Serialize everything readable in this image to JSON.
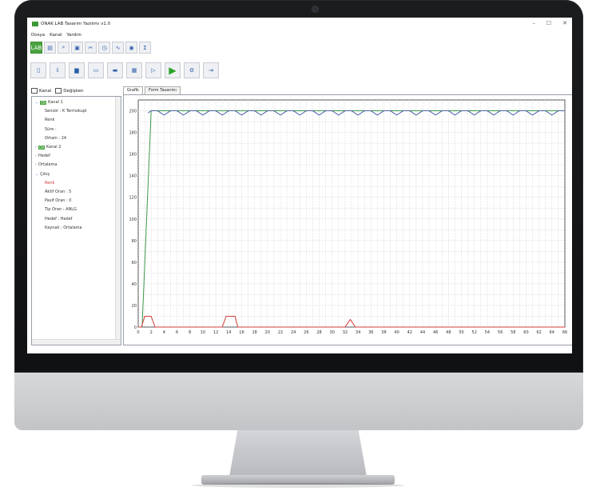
{
  "app": {
    "title": "ONAK LAB Tasarım Yazılımı v1.0"
  },
  "window_buttons": [
    "–",
    "☐",
    "✕"
  ],
  "menu": [
    "Dosya",
    "Kanal",
    "Yardım"
  ],
  "toolbar_row1": [
    {
      "icon": "lab-icon",
      "label": "LAB"
    },
    {
      "icon": "document-icon",
      "label": "▤"
    },
    {
      "icon": "search-doc-icon",
      "label": "⌕"
    },
    {
      "icon": "clipboard-icon",
      "label": "▣"
    },
    {
      "icon": "tools-icon",
      "label": "✂"
    },
    {
      "icon": "gauge-icon",
      "label": "◷"
    },
    {
      "icon": "wave-icon",
      "label": "∿"
    },
    {
      "icon": "eye-icon",
      "label": "◉"
    },
    {
      "icon": "sigma-icon",
      "label": "Σ"
    }
  ],
  "toolbar_row2": [
    {
      "icon": "new-file-icon",
      "label": "▯"
    },
    {
      "icon": "export-icon",
      "label": "⇩"
    },
    {
      "icon": "save-icon",
      "label": "▆"
    },
    {
      "icon": "folder-icon",
      "label": "▭"
    },
    {
      "icon": "monitor-icon",
      "label": "▬"
    },
    {
      "icon": "table-icon",
      "label": "▦"
    },
    {
      "icon": "play-outline-icon",
      "label": "▷"
    },
    {
      "icon": "play-icon",
      "label": "▶"
    },
    {
      "icon": "settings-icon",
      "label": "⚙"
    },
    {
      "icon": "exit-icon",
      "label": "⇥"
    }
  ],
  "left_tabs": [
    "Kanal",
    "Değişken"
  ],
  "tree": [
    {
      "text": "Kanal 1",
      "badge": "CH",
      "level": 0,
      "expander": "⌄"
    },
    {
      "text": "Sensör : K Termokupl",
      "level": 1
    },
    {
      "text": "Renk",
      "level": 1
    },
    {
      "text": "Süre :",
      "level": 1
    },
    {
      "text": "Ortam : 24",
      "level": 1
    },
    {
      "text": "Kanal 2",
      "badge": "CH",
      "level": 0,
      "expander": "›"
    },
    {
      "text": "Hedef",
      "level": 0,
      "expander": "›"
    },
    {
      "text": "Ortalama",
      "level": 0,
      "expander": "›"
    },
    {
      "text": "Çıkış",
      "level": 0,
      "expander": "⌄"
    },
    {
      "text": "Renk",
      "level": 1,
      "color": "#d43b3b"
    },
    {
      "text": "Aktif Oran : 5",
      "level": 1
    },
    {
      "text": "Pasif Oran : 0",
      "level": 1
    },
    {
      "text": "Tip Oran : ANLG",
      "level": 1
    },
    {
      "text": "Hedef : Hedef",
      "level": 1
    },
    {
      "text": "Kaynak : Ortalama",
      "level": 1
    }
  ],
  "main_tabs": [
    "Grafik",
    "Form Tasarımı"
  ],
  "chart_data": {
    "type": "line",
    "xlim": [
      0,
      66
    ],
    "ylim": [
      0,
      210
    ],
    "x_ticks": [
      0,
      2,
      4,
      6,
      8,
      10,
      12,
      14,
      16,
      18,
      20,
      22,
      24,
      26,
      28,
      30,
      32,
      34,
      36,
      38,
      40,
      42,
      44,
      46,
      48,
      50,
      52,
      54,
      56,
      58,
      60,
      62,
      64,
      66
    ],
    "y_ticks": [
      0,
      20,
      40,
      60,
      80,
      100,
      120,
      140,
      160,
      180,
      200
    ],
    "grid": true,
    "series": [
      {
        "color": "#3c9a4a",
        "x": [
          0,
          0.2,
          0.6,
          2,
          66
        ],
        "y": [
          0,
          0,
          0,
          200,
          200
        ]
      },
      {
        "color": "#4a62a8",
        "x": [
          1.5,
          2,
          3,
          4,
          5,
          6,
          7,
          8,
          9,
          10,
          11,
          12,
          13,
          14,
          15,
          16,
          17,
          18,
          19,
          20,
          21,
          22,
          23,
          24,
          25,
          26,
          27,
          28,
          29,
          30,
          31,
          32,
          33,
          34,
          35,
          36,
          37,
          38,
          39,
          40,
          41,
          42,
          43,
          44,
          45,
          46,
          47,
          48,
          49,
          50,
          51,
          52,
          53,
          54,
          55,
          56,
          57,
          58,
          59,
          60,
          61,
          62,
          63,
          64,
          65,
          66
        ],
        "y": [
          198,
          200,
          200,
          196,
          200,
          200,
          196,
          200,
          200,
          196,
          200,
          200,
          196,
          200,
          200,
          196,
          200,
          200,
          196,
          200,
          200,
          196,
          200,
          200,
          196,
          200,
          200,
          196,
          200,
          200,
          196,
          200,
          200,
          196,
          200,
          200,
          196,
          200,
          200,
          196,
          200,
          200,
          196,
          200,
          200,
          196,
          200,
          200,
          196,
          200,
          200,
          196,
          200,
          200,
          196,
          200,
          200,
          196,
          200,
          200,
          196,
          200,
          200,
          196,
          200,
          200
        ]
      },
      {
        "color": "#d43b3b",
        "x": [
          0,
          0.5,
          1,
          2,
          2.6,
          3,
          13,
          13.6,
          14,
          15,
          15.4,
          32,
          32.8,
          33.6,
          66
        ],
        "y": [
          0,
          0,
          10,
          10,
          0,
          0,
          0,
          10,
          10,
          10,
          0,
          0,
          7,
          0,
          0
        ]
      }
    ]
  }
}
